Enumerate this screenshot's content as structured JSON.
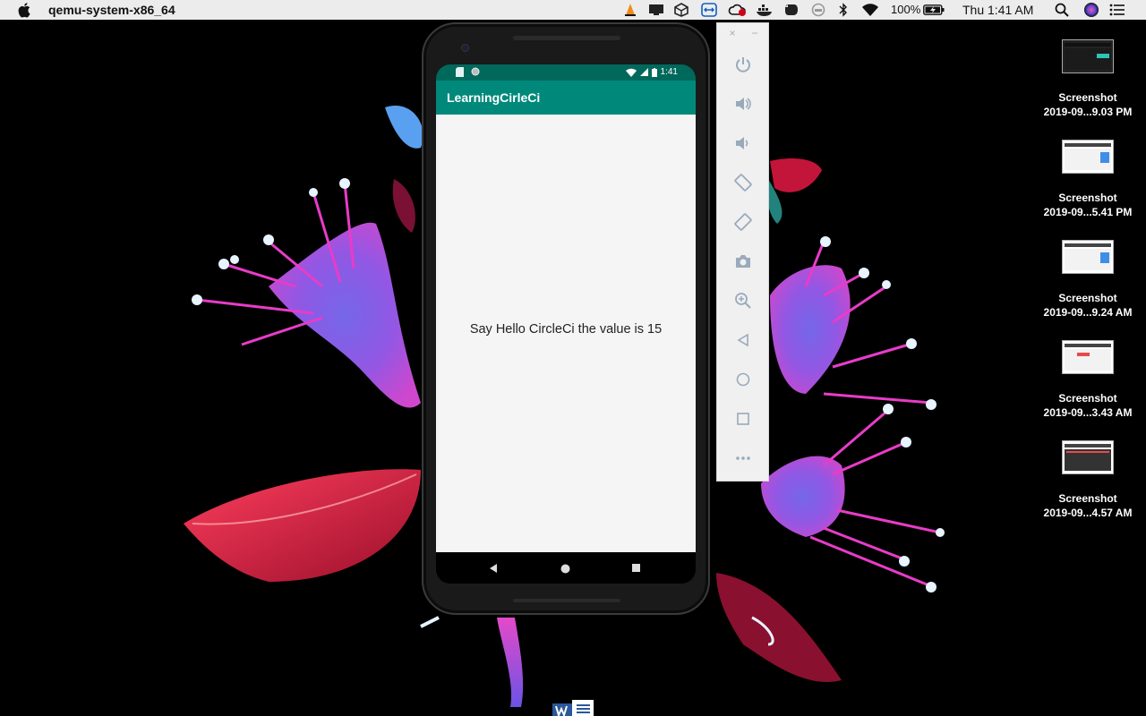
{
  "menubar": {
    "app_name": "qemu-system-x86_64",
    "battery_percent": "100%",
    "clock": "Thu 1:41 AM",
    "icons": [
      "vlc-icon",
      "screen-icon",
      "box-icon",
      "teamviewer-icon",
      "creative-cloud-icon",
      "docker-icon",
      "evernote-icon",
      "helmet-icon",
      "bluetooth-icon",
      "wifi-icon",
      "battery-icon",
      "search-icon",
      "siri-icon",
      "menu-icon"
    ]
  },
  "emulator": {
    "statusbar": {
      "time": "1:41"
    },
    "app_title": "LearningCirleCi",
    "message": "Say Hello CircleCi the value is 15",
    "accent_color": "#00897b",
    "statusbar_color": "#00695c"
  },
  "emulator_toolbar": {
    "close": "×",
    "minimize": "−",
    "tools": [
      "power-icon",
      "volume-up-icon",
      "volume-down-icon",
      "rotate-left-icon",
      "rotate-right-icon",
      "camera-icon",
      "zoom-icon",
      "back-icon",
      "home-icon",
      "overview-icon",
      "more-icon"
    ]
  },
  "desktop_items": [
    {
      "name": "Screenshot",
      "detail": "2019-09...9.03 PM"
    },
    {
      "name": "Screenshot",
      "detail": "2019-09...5.41 PM"
    },
    {
      "name": "Screenshot",
      "detail": "2019-09...9.24 AM"
    },
    {
      "name": "Screenshot",
      "detail": "2019-09...3.43 AM"
    },
    {
      "name": "Screenshot",
      "detail": "2019-09...4.57 AM"
    }
  ]
}
